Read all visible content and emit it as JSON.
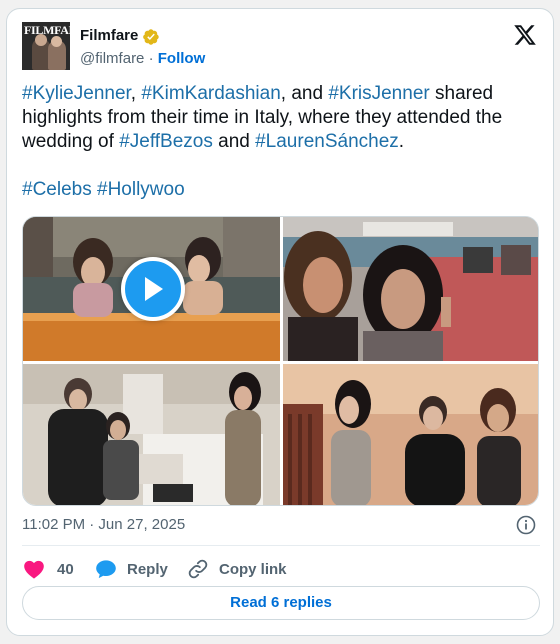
{
  "author": {
    "display_name": "Filmfare",
    "handle": "@filmfare",
    "separator": "·",
    "follow_label": "Follow",
    "avatar_masthead": "FILMFARE",
    "verified_color": "#e2b719"
  },
  "tweet": {
    "lines": [
      [
        {
          "t": "#KylieJenner",
          "tag": true
        },
        {
          "t": ", ",
          "tag": false
        },
        {
          "t": "#KimKardashian",
          "tag": true
        },
        {
          "t": ", and ",
          "tag": false
        },
        {
          "t": "#KrisJenner",
          "tag": true
        },
        {
          "t": " shared",
          "tag": false
        }
      ],
      [
        {
          "t": "highlights from their time in Italy, where they attended the",
          "tag": false
        }
      ],
      [
        {
          "t": "wedding of ",
          "tag": false
        },
        {
          "t": "#JeffBezos",
          "tag": true
        },
        {
          "t": " and ",
          "tag": false
        },
        {
          "t": "#LaurenSánchez",
          "tag": true
        },
        {
          "t": ".",
          "tag": false
        }
      ],
      [],
      [
        {
          "t": "#Celebs",
          "tag": true
        },
        {
          "t": " ",
          "tag": false
        },
        {
          "t": "#Hollywoo",
          "tag": true
        }
      ]
    ],
    "hashtag_color": "#1d6fa8"
  },
  "media": {
    "items": [
      {
        "kind": "video",
        "scene": "boat-canal"
      },
      {
        "kind": "photo",
        "scene": "selfie-boat"
      },
      {
        "kind": "photo",
        "scene": "hotel-room"
      },
      {
        "kind": "photo",
        "scene": "staircase-group"
      }
    ],
    "play_color": "#1d9bf0"
  },
  "footer": {
    "timestamp": "11:02 PM · Jun 27, 2025",
    "like_count": "40",
    "reply_label": "Reply",
    "copy_label": "Copy link",
    "read_replies": "Read 6 replies",
    "like_color": "#f91880",
    "reply_color": "#1d9bf0"
  },
  "icons": [
    "verified-badge-icon",
    "x-logo-icon",
    "play-icon",
    "info-icon",
    "heart-icon",
    "reply-bubble-icon",
    "link-icon"
  ]
}
